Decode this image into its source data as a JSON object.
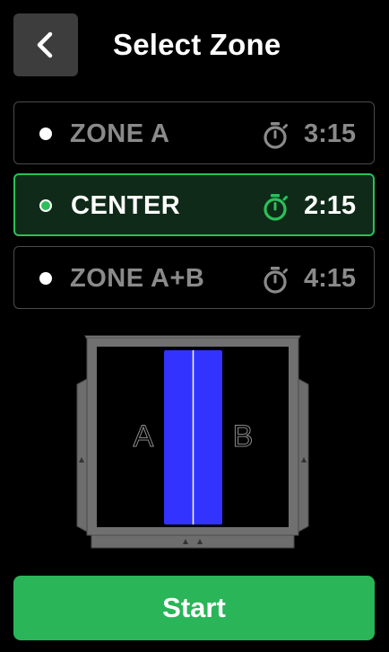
{
  "header": {
    "back_icon": "chevron-left-icon",
    "title": "Select Zone"
  },
  "zones": [
    {
      "name": "ZONE A",
      "time": "3:15",
      "selected": false
    },
    {
      "name": "CENTER",
      "time": "2:15",
      "selected": true
    },
    {
      "name": "ZONE A+B",
      "time": "4:15",
      "selected": false
    }
  ],
  "field": {
    "label_left": "A",
    "label_right": "B",
    "highlighted_zone": "center"
  },
  "start_label": "Start",
  "colors": {
    "accent_green": "#2bc05a",
    "selected_bg": "#0f2a18",
    "zone_blue": "#3333ff",
    "muted_text": "#8a8a8a",
    "button_bg": "#3d3d3d"
  }
}
